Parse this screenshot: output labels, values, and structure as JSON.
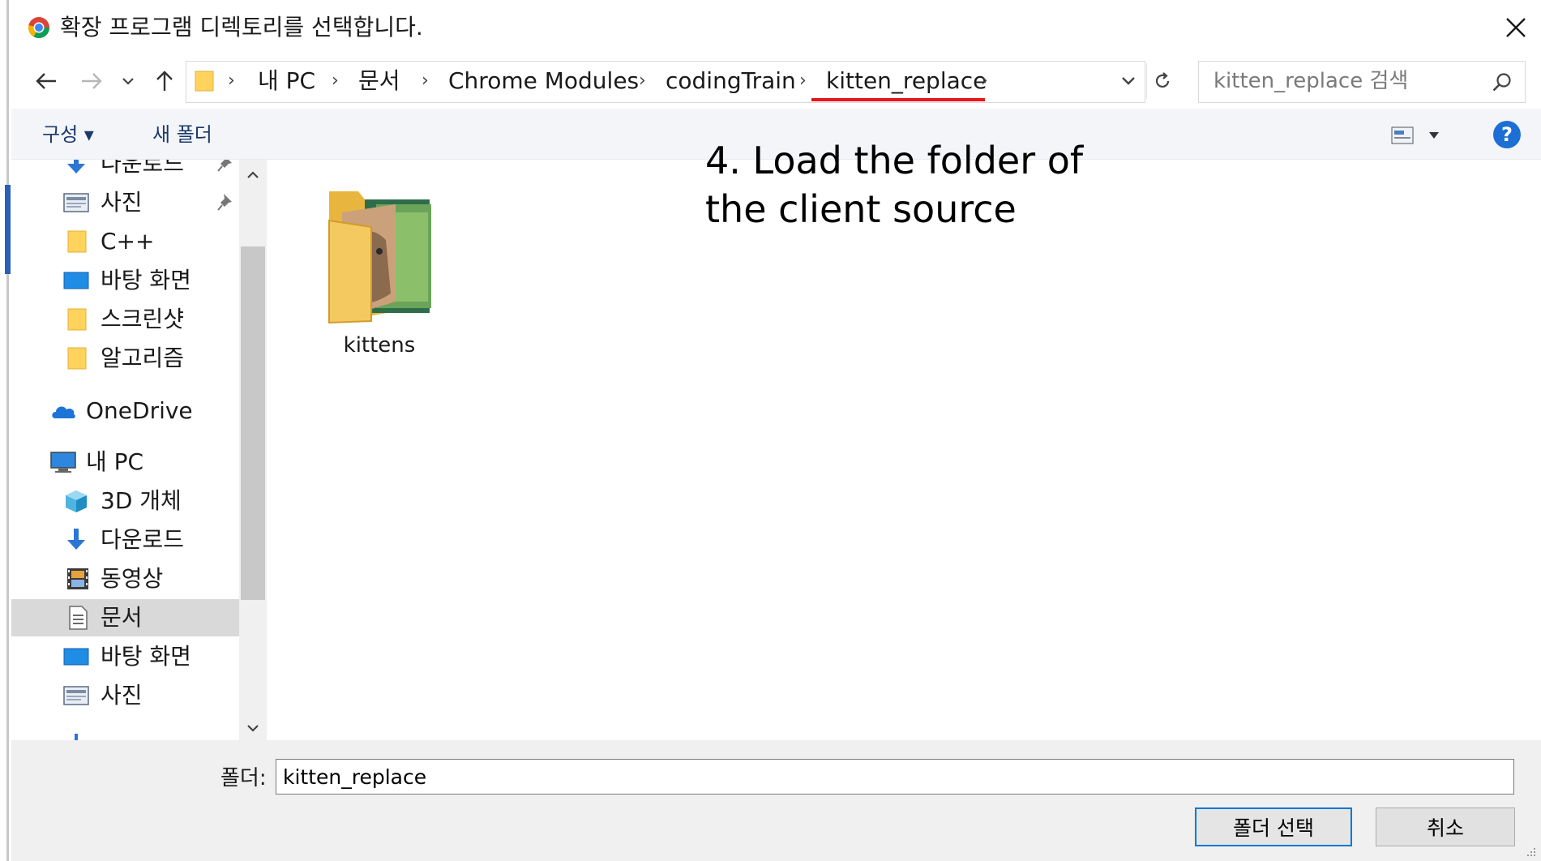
{
  "window": {
    "title": "확장 프로그램 디렉토리를 선택합니다."
  },
  "address": {
    "crumbs": [
      "내 PC",
      "문서",
      "Chrome Modules",
      "codingTrain",
      "kitten_replace"
    ]
  },
  "search": {
    "placeholder": "kitten_replace 검색"
  },
  "toolbar": {
    "organize_label": "구성 ▾",
    "new_folder_label": "새 폴더"
  },
  "nav": {
    "items": [
      {
        "label": "다운로드",
        "icon": "download-arrow-icon"
      },
      {
        "label": "사진",
        "icon": "pictures-icon"
      },
      {
        "label": "C++",
        "icon": "folder-icon"
      },
      {
        "label": "바탕 화면",
        "icon": "desktop-icon"
      },
      {
        "label": "스크린샷",
        "icon": "folder-icon"
      },
      {
        "label": "알고리즘",
        "icon": "folder-icon"
      },
      {
        "label": "OneDrive",
        "icon": "onedrive-cloud-icon"
      },
      {
        "label": "내 PC",
        "icon": "computer-icon"
      },
      {
        "label": "3D 개체",
        "icon": "3d-objects-icon"
      },
      {
        "label": "다운로드",
        "icon": "download-arrow-icon"
      },
      {
        "label": "동영상",
        "icon": "video-icon"
      },
      {
        "label": "문서",
        "icon": "documents-icon"
      },
      {
        "label": "바탕 화면",
        "icon": "desktop-icon"
      },
      {
        "label": "사진",
        "icon": "pictures-icon"
      }
    ]
  },
  "content": {
    "items": [
      {
        "name": "kittens",
        "type": "folder"
      }
    ]
  },
  "annotation": {
    "line1": "4. Load the folder of",
    "line2": "the client source"
  },
  "bottom": {
    "folder_label": "폴더:",
    "folder_value": "kitten_replace",
    "select_label": "폴더 선택",
    "cancel_label": "취소"
  },
  "colors": {
    "accent": "#0078d7",
    "highlight_underline": "#e8151b",
    "help": "#1c6fd4"
  }
}
